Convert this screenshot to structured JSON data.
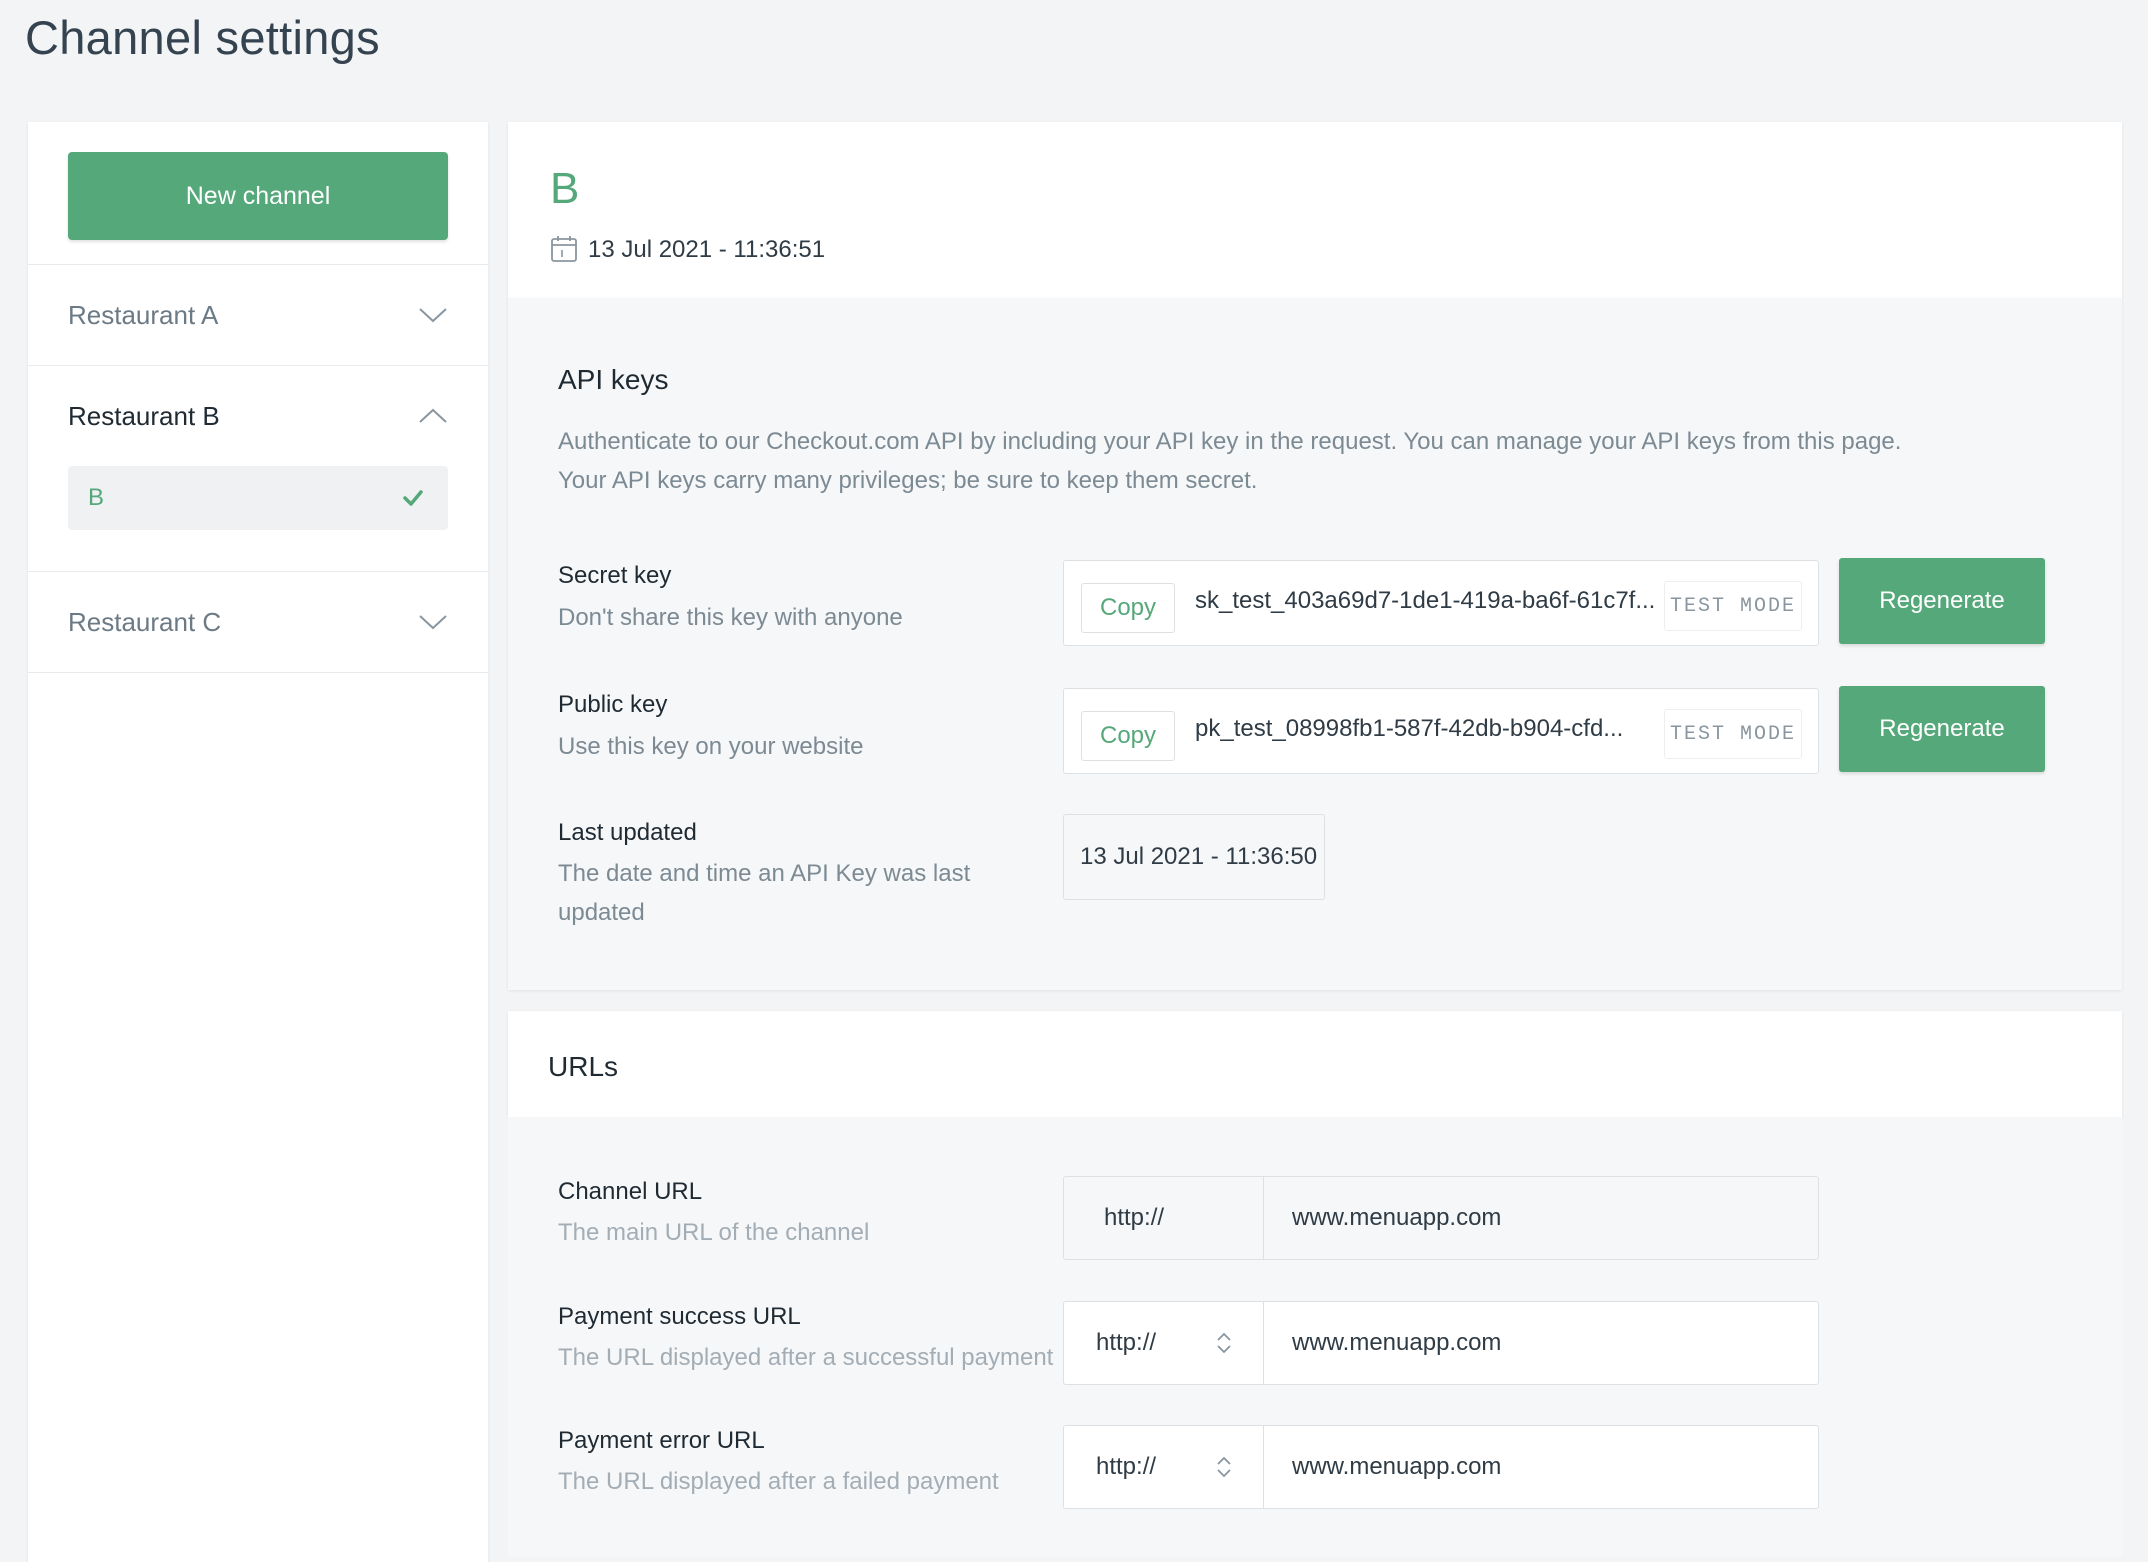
{
  "page": {
    "title": "Channel settings"
  },
  "sidebar": {
    "new_channel_label": "New channel",
    "groups": [
      {
        "label": "Restaurant A",
        "expanded": false
      },
      {
        "label": "Restaurant B",
        "expanded": true,
        "items": [
          {
            "label": "B",
            "selected": true
          }
        ]
      },
      {
        "label": "Restaurant C",
        "expanded": false
      }
    ]
  },
  "channel": {
    "name": "B",
    "created": "13 Jul 2021 - 11:36:51"
  },
  "api_keys": {
    "title": "API keys",
    "description_line1": "Authenticate to our Checkout.com API by including your API key in the request. You can manage your API keys from this page.",
    "description_line2": "Your API keys carry many privileges; be sure to keep them secret.",
    "copy_label": "Copy",
    "regenerate_label": "Regenerate",
    "test_mode_label": "TEST MODE",
    "secret": {
      "label": "Secret key",
      "help": "Don't share this key with anyone",
      "value": "sk_test_403a69d7-1de1-419a-ba6f-61c7f..."
    },
    "public": {
      "label": "Public key",
      "help": "Use this key on your website",
      "value": "pk_test_08998fb1-587f-42db-b904-cfd..."
    },
    "last_updated": {
      "label": "Last updated",
      "help_line1": "The date and time an API Key was last",
      "help_line2": "updated",
      "value": "13 Jul 2021 - 11:36:50"
    }
  },
  "urls": {
    "title": "URLs",
    "channel_url": {
      "label": "Channel URL",
      "help": "The main URL of the channel",
      "protocol": "http://",
      "value": "www.menuapp.com"
    },
    "success_url": {
      "label": "Payment success URL",
      "help": "The URL displayed after a successful payment",
      "protocol": "http://",
      "value": "www.menuapp.com"
    },
    "error_url": {
      "label": "Payment error URL",
      "help": "The URL displayed after a failed payment",
      "protocol": "http://",
      "value": "www.menuapp.com"
    }
  },
  "colors": {
    "accent": "#55a87a",
    "background": "#f3f4f6",
    "text": "#2f3b45",
    "muted": "#7c8a94"
  }
}
